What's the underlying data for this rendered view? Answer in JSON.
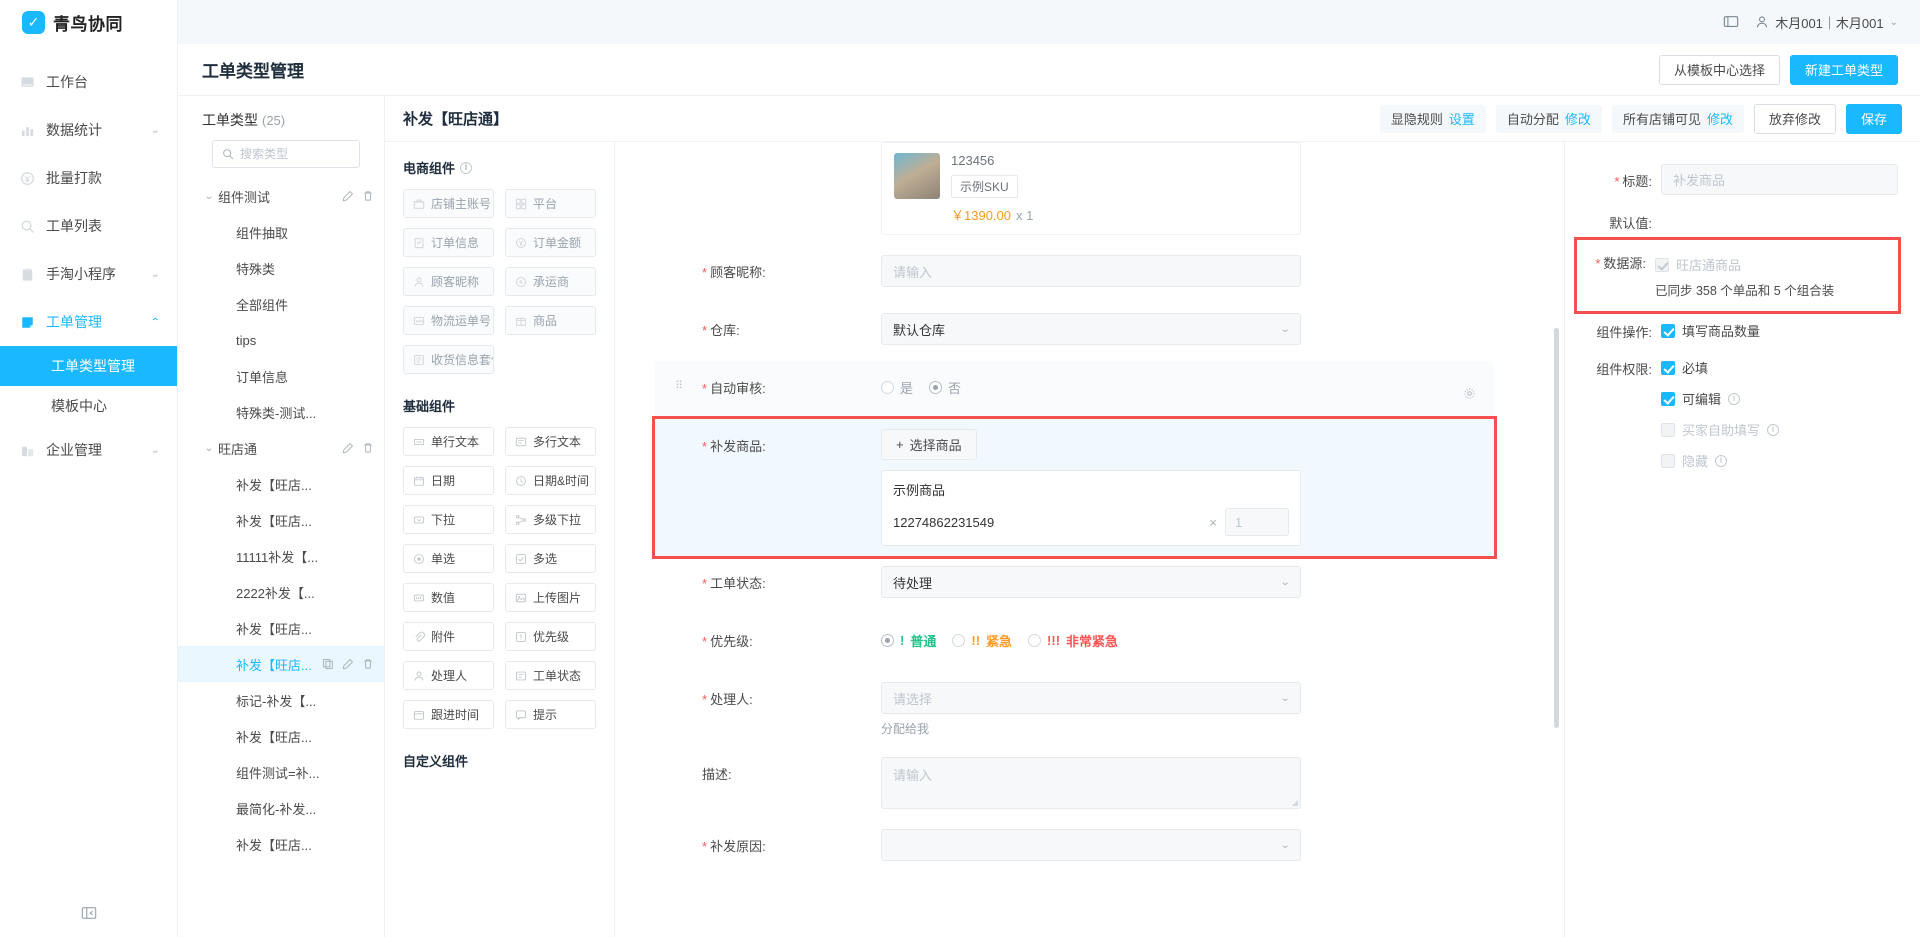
{
  "brand": {
    "name": "青鸟协同",
    "mark": "✓"
  },
  "topbar": {
    "screen_icon": "monitor-icon",
    "user_icon": "user-icon",
    "user_name": "木月001｜木月001",
    "caret": "⌄"
  },
  "leftnav": {
    "items": [
      {
        "label": "工作台",
        "icon": "workbench-icon",
        "expandable": false
      },
      {
        "label": "数据统计",
        "icon": "chart-icon",
        "expandable": true
      },
      {
        "label": "批量打款",
        "icon": "payment-icon",
        "expandable": false
      },
      {
        "label": "工单列表",
        "icon": "ticket-list-icon",
        "expandable": false
      },
      {
        "label": "手淘小程序",
        "icon": "miniapp-icon",
        "expandable": true
      },
      {
        "label": "工单管理",
        "icon": "ticket-manage-icon",
        "expandable": true,
        "active": true
      }
    ],
    "sub_items": [
      {
        "label": "工单类型管理",
        "selected": true
      },
      {
        "label": "模板中心",
        "selected": false
      }
    ],
    "tail_items": [
      {
        "label": "企业管理",
        "icon": "enterprise-icon",
        "expandable": true
      }
    ],
    "collapse_icon": "collapse-icon"
  },
  "page": {
    "title": "工单类型管理",
    "btn_template_center": "从模板中心选择",
    "btn_new_type": "新建工单类型"
  },
  "tree": {
    "title": "工单类型",
    "count": "(25)",
    "search_placeholder": "搜索类型",
    "search_value": "",
    "nodes": [
      {
        "label": "组件测试",
        "type": "group",
        "twist": "⌄",
        "tools": [
          "edit-icon",
          "delete-icon"
        ]
      },
      {
        "label": "组件抽取",
        "type": "leaf"
      },
      {
        "label": "特殊类",
        "type": "leaf"
      },
      {
        "label": "全部组件",
        "type": "leaf"
      },
      {
        "label": "tips",
        "type": "leaf"
      },
      {
        "label": "订单信息",
        "type": "leaf"
      },
      {
        "label": "特殊类-测试...",
        "type": "leaf"
      },
      {
        "label": "旺店通",
        "type": "group",
        "twist": "⌄",
        "tools": [
          "edit-icon",
          "delete-icon"
        ]
      },
      {
        "label": "补发【旺店...",
        "type": "leaf"
      },
      {
        "label": "补发【旺店...",
        "type": "leaf"
      },
      {
        "label": "11111补发【...",
        "type": "leaf"
      },
      {
        "label": "2222补发【...",
        "type": "leaf"
      },
      {
        "label": "补发【旺店...",
        "type": "leaf"
      },
      {
        "label": "补发【旺店...",
        "type": "leaf",
        "selected": true,
        "tools": [
          "copy-icon",
          "edit-icon",
          "delete-icon"
        ]
      },
      {
        "label": "标记-补发【...",
        "type": "leaf"
      },
      {
        "label": "补发【旺店...",
        "type": "leaf"
      },
      {
        "label": "组件测试=补...",
        "type": "leaf"
      },
      {
        "label": "最简化-补发...",
        "type": "leaf"
      },
      {
        "label": "补发【旺店...",
        "type": "leaf"
      }
    ]
  },
  "builder": {
    "title": "补发【旺店通】",
    "chips": [
      {
        "label": "显隐规则",
        "link": "设置"
      },
      {
        "label": "自动分配",
        "link": "修改"
      },
      {
        "label": "所有店铺可见",
        "link": "修改"
      }
    ],
    "btn_discard": "放弃修改",
    "btn_save": "保存"
  },
  "palette": {
    "ecom_title": "电商组件",
    "ecom_info_icon": "info-icon",
    "ecom_items": [
      {
        "label": "店铺主账号",
        "icon": "shop-icon"
      },
      {
        "label": "平台",
        "icon": "platform-icon"
      },
      {
        "label": "订单信息",
        "icon": "order-icon"
      },
      {
        "label": "订单金额",
        "icon": "amount-icon"
      },
      {
        "label": "顾客昵称",
        "icon": "person-icon"
      },
      {
        "label": "承运商",
        "icon": "carrier-icon"
      },
      {
        "label": "物流运单号",
        "icon": "tracking-icon"
      },
      {
        "label": "商品",
        "icon": "product-icon"
      },
      {
        "label": "收货信息套件",
        "icon": "address-kit-icon"
      }
    ],
    "basic_title": "基础组件",
    "basic_items": [
      {
        "label": "单行文本",
        "icon": "single-line-icon"
      },
      {
        "label": "多行文本",
        "icon": "multi-line-icon"
      },
      {
        "label": "日期",
        "icon": "date-icon"
      },
      {
        "label": "日期&时间",
        "icon": "datetime-icon"
      },
      {
        "label": "下拉",
        "icon": "dropdown-icon"
      },
      {
        "label": "多级下拉",
        "icon": "cascader-icon"
      },
      {
        "label": "单选",
        "icon": "radio-icon"
      },
      {
        "label": "多选",
        "icon": "checkbox-icon"
      },
      {
        "label": "数值",
        "icon": "number-icon"
      },
      {
        "label": "上传图片",
        "icon": "image-upload-icon"
      },
      {
        "label": "附件",
        "icon": "attachment-icon"
      },
      {
        "label": "优先级",
        "icon": "priority-icon"
      },
      {
        "label": "处理人",
        "icon": "assignee-icon"
      },
      {
        "label": "工单状态",
        "icon": "status-icon"
      },
      {
        "label": "跟进时间",
        "icon": "followup-icon"
      },
      {
        "label": "提示",
        "icon": "tip-icon"
      }
    ],
    "custom_title": "自定义组件"
  },
  "canvas": {
    "product_card": {
      "thumb": "product-thumbnail",
      "title": "123456",
      "sku_tag": "示例SKU",
      "price": "￥1390.00",
      "qty": "x 1"
    },
    "rows": [
      {
        "label": "顾客昵称:",
        "required": true,
        "control": "input",
        "placeholder": "请输入"
      },
      {
        "label": "仓库:",
        "required": true,
        "control": "select",
        "value": "默认仓库"
      },
      {
        "label": "自动审核:",
        "required": true,
        "control": "radio-yesno",
        "options": [
          "是",
          "否"
        ],
        "selected": "否",
        "drag": true,
        "gear": "gear-icon"
      },
      {
        "label": "补发商品:",
        "required": true,
        "control": "product-picker",
        "highlight": true,
        "choose_label": "选择商品",
        "choose_plus": "+",
        "selected_name": "示例商品",
        "selected_code": "12274862231549",
        "remove": "×",
        "qty_value": "1"
      },
      {
        "label": "工单状态:",
        "required": true,
        "control": "select",
        "value": "待处理"
      },
      {
        "label": "优先级:",
        "required": true,
        "control": "priority",
        "options": [
          {
            "mark": "!",
            "label": "普通",
            "selected": true
          },
          {
            "mark": "!!",
            "label": "紧急",
            "selected": false
          },
          {
            "mark": "!!!",
            "label": "非常紧急",
            "selected": false
          }
        ]
      },
      {
        "label": "处理人:",
        "required": true,
        "control": "select",
        "placeholder": "请选择",
        "note": "分配给我"
      },
      {
        "label": "描述:",
        "required": false,
        "control": "textarea",
        "placeholder": "请输入"
      },
      {
        "label": "补发原因:",
        "required": true,
        "control": "select",
        "value": ""
      }
    ]
  },
  "props": {
    "title_label": "标题:",
    "title_required": true,
    "title_value": "补发商品",
    "default_label": "默认值:",
    "datasource_label": "数据源:",
    "datasource_required": true,
    "datasource_checkbox_label": "旺店通商品",
    "datasource_checkbox_checked": true,
    "datasource_checkbox_disabled": true,
    "datasource_note": "已同步 358 个单品和 5 个组合装",
    "op_label": "组件操作:",
    "op_items": [
      {
        "label": "填写商品数量",
        "checked": true,
        "disabled": false,
        "info": false
      }
    ],
    "perm_label": "组件权限:",
    "perm_items": [
      {
        "label": "必填",
        "checked": true,
        "disabled": false,
        "info": false
      },
      {
        "label": "可编辑",
        "checked": true,
        "disabled": false,
        "info": true
      },
      {
        "label": "买家自助填写",
        "checked": false,
        "disabled": true,
        "info": true
      },
      {
        "label": "隐藏",
        "checked": false,
        "disabled": true,
        "info": true
      }
    ],
    "info_icon": "info-icon"
  }
}
